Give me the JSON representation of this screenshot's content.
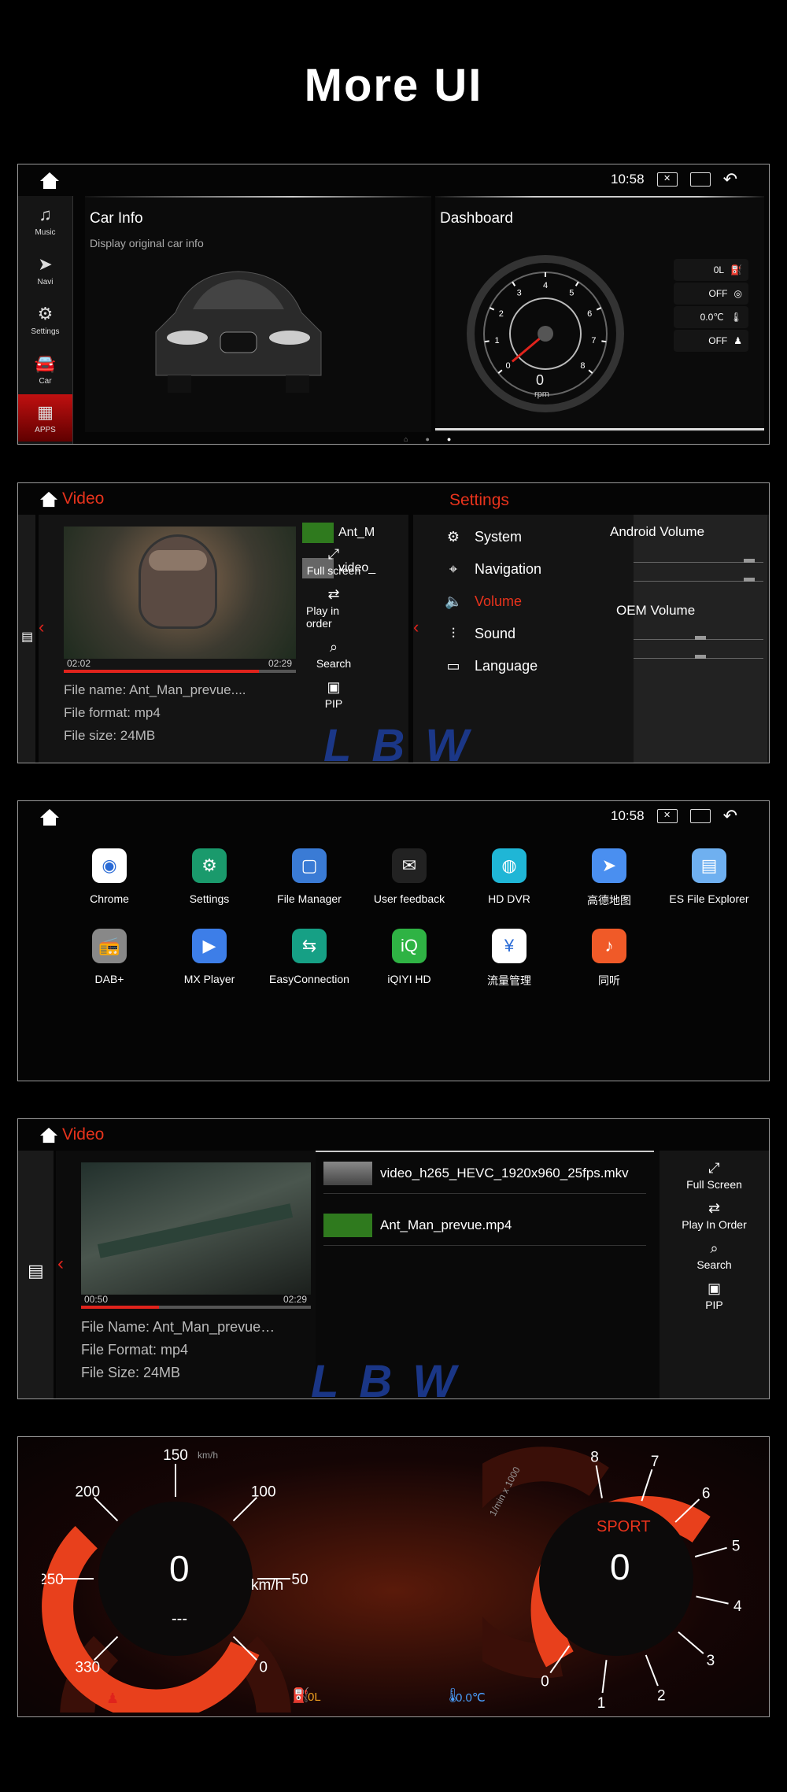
{
  "page_title": "More UI",
  "status": {
    "time": "10:58"
  },
  "panel1": {
    "sidebar": [
      {
        "label": "Music",
        "icon": "music-icon"
      },
      {
        "label": "Navi",
        "icon": "navi-icon"
      },
      {
        "label": "Settings",
        "icon": "gear-icon"
      },
      {
        "label": "Car",
        "icon": "car-icon"
      },
      {
        "label": "APPS",
        "icon": "apps-icon"
      }
    ],
    "car_info": {
      "title": "Car Info",
      "subtitle": "Display original car info"
    },
    "dashboard": {
      "title": "Dashboard",
      "rpm_value": "0",
      "rpm_unit": "rpm",
      "ticks": [
        "0",
        "1",
        "2",
        "3",
        "4",
        "5",
        "6",
        "7",
        "8"
      ],
      "indicators": [
        {
          "value": "0L",
          "icon": "fuel-icon"
        },
        {
          "value": "OFF",
          "icon": "brake-icon"
        },
        {
          "value": "0.0℃",
          "icon": "thermometer-icon"
        },
        {
          "value": "OFF",
          "icon": "seatbelt-icon"
        }
      ]
    }
  },
  "panel2": {
    "video_title": "Video",
    "settings_title": "Settings",
    "player": {
      "elapsed": "02:02",
      "total": "02:29",
      "progress": 0.84,
      "info": [
        "File name: Ant_Man_prevue....",
        "File format: mp4",
        "File size: 24MB"
      ],
      "list": [
        "Ant_M",
        "video_"
      ],
      "buttons": [
        {
          "label": "Full screen",
          "icon": "fullscreen-icon"
        },
        {
          "label": "Play in order",
          "icon": "order-icon"
        },
        {
          "label": "Search",
          "icon": "search-icon"
        },
        {
          "label": "PIP",
          "icon": "pip-icon"
        }
      ]
    },
    "menu": [
      {
        "label": "System",
        "icon": "gear-icon",
        "active": false
      },
      {
        "label": "Navigation",
        "icon": "location-icon",
        "active": false
      },
      {
        "label": "Volume",
        "icon": "volume-icon",
        "active": true
      },
      {
        "label": "Sound",
        "icon": "equalizer-icon",
        "active": false
      },
      {
        "label": "Language",
        "icon": "language-icon",
        "active": false
      }
    ],
    "volume": {
      "android_label": "Android Volume",
      "oem_label": "OEM Volume"
    }
  },
  "panel3": {
    "apps": [
      {
        "label": "Chrome",
        "icon": "chrome-icon",
        "color": "#ffffff"
      },
      {
        "label": "Settings",
        "icon": "gear-icon",
        "color": "#1a9a6c"
      },
      {
        "label": "File Manager",
        "icon": "folder-icon",
        "color": "#3a7bd5"
      },
      {
        "label": "User feedback",
        "icon": "feedback-icon",
        "color": "#222222"
      },
      {
        "label": "HD DVR",
        "icon": "dvr-icon",
        "color": "#1fb6d6"
      },
      {
        "label": "高德地图",
        "icon": "map-icon",
        "color": "#4a8ff0"
      },
      {
        "label": "ES File Explorer",
        "icon": "es-folder-icon",
        "color": "#6fb0f0"
      },
      {
        "label": "DAB+",
        "icon": "radio-icon",
        "color": "#888888"
      },
      {
        "label": "MX Player",
        "icon": "play-icon",
        "color": "#3d7ee8"
      },
      {
        "label": "EasyConnection",
        "icon": "connection-icon",
        "color": "#16a085"
      },
      {
        "label": "iQIYI HD",
        "icon": "iqiyi-icon",
        "color": "#2fb344"
      },
      {
        "label": "流量管理",
        "icon": "data-usage-icon",
        "color": "#ffffff"
      },
      {
        "label": "同听",
        "icon": "music-app-icon",
        "color": "#f05a28"
      }
    ]
  },
  "panel4": {
    "video_title": "Video",
    "player": {
      "elapsed": "00:50",
      "total": "02:29",
      "progress": 0.34,
      "info": [
        "File Name: Ant_Man_prevue…",
        "File Format: mp4",
        "File Size: 24MB"
      ],
      "list": [
        "video_h265_HEVC_1920x960_25fps.mkv",
        "Ant_Man_prevue.mp4"
      ],
      "buttons": [
        {
          "label": "Full Screen",
          "icon": "fullscreen-icon"
        },
        {
          "label": "Play In Order",
          "icon": "order-icon"
        },
        {
          "label": "Search",
          "icon": "search-icon"
        },
        {
          "label": "PIP",
          "icon": "pip-icon"
        }
      ]
    }
  },
  "panel5": {
    "speed": {
      "value": "0",
      "unit": "km/h",
      "unit_top": "km/h",
      "sub": "---",
      "ticks": [
        "0",
        "50",
        "100",
        "150",
        "200",
        "250",
        "330"
      ]
    },
    "tach": {
      "value": "0",
      "mode": "SPORT",
      "axis": "1/min x 1000",
      "ticks": [
        "0",
        "1",
        "2",
        "3",
        "4",
        "5",
        "6",
        "7",
        "8"
      ]
    },
    "bottom": {
      "fuel": "0L",
      "temp": "0.0℃"
    }
  },
  "watermark": "LBW"
}
